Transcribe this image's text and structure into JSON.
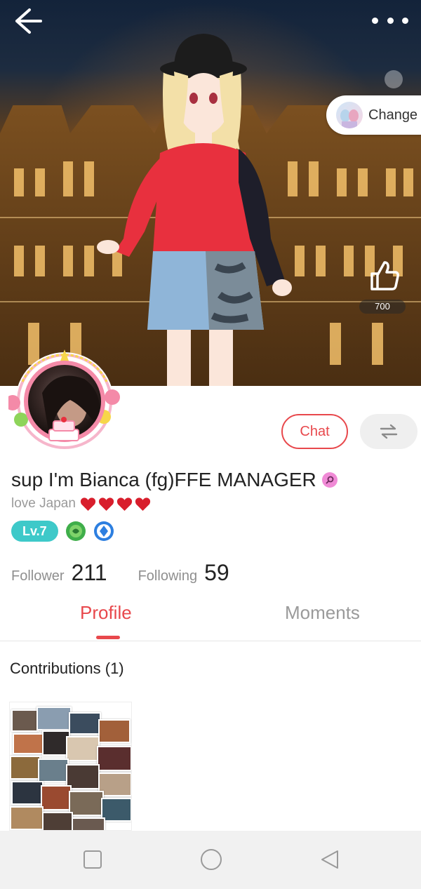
{
  "header": {
    "back_icon": "arrow-left-icon",
    "more_icon": "more-horizontal-icon",
    "change_label": "Change"
  },
  "likes": {
    "icon": "thumbs-up-icon",
    "count": "700"
  },
  "avatar": {
    "frame_text": "happy Birthday"
  },
  "actions": {
    "chat_label": "Chat",
    "swap_icon": "swap-arrows-icon"
  },
  "profile": {
    "name": "sup I'm Bianca (fg)FFE MANAGER",
    "gender_icon": "female-icon",
    "bio": "love Japan",
    "bio_hearts": 4,
    "level": "Lv.7",
    "badges": [
      "green-badge-icon",
      "blue-badge-icon"
    ],
    "follower_label": "Follower",
    "follower_count": "211",
    "following_label": "Following",
    "following_count": "59"
  },
  "tabs": [
    {
      "label": "Profile",
      "active": true
    },
    {
      "label": "Moments",
      "active": false
    }
  ],
  "contributions": {
    "title": "Contributions (1)"
  },
  "navbar": {
    "icons": [
      "square-recent-icon",
      "circle-home-icon",
      "triangle-back-icon"
    ]
  },
  "colors": {
    "accent": "#e8484c",
    "level": "#3ec9c9",
    "gender": "#f08ad6"
  }
}
